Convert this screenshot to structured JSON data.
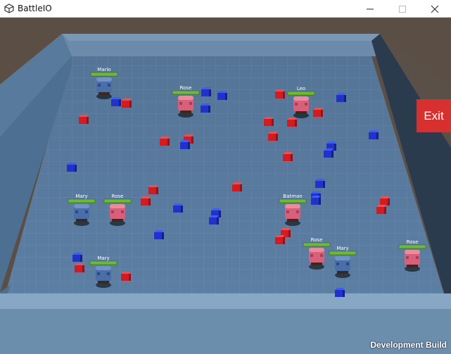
{
  "window": {
    "title": "BattleIO"
  },
  "ui": {
    "exit_label": "Exit",
    "build_label": "Development Build"
  },
  "colors": {
    "blue_team": "#2a3cd8",
    "red_team": "#e0202a",
    "exit_button": "#d8302f",
    "health_bar": "#6cbc2c"
  },
  "players": [
    {
      "name": "Mario",
      "team": "blue"
    },
    {
      "name": "Rose",
      "team": "red"
    },
    {
      "name": "Leo",
      "team": "red"
    },
    {
      "name": "Mary",
      "team": "blue"
    },
    {
      "name": "Rose",
      "team": "red"
    },
    {
      "name": "Batman",
      "team": "red"
    },
    {
      "name": "Mary",
      "team": "blue"
    },
    {
      "name": "Rose",
      "team": "red"
    },
    {
      "name": "Mary",
      "team": "blue"
    },
    {
      "name": "Rose",
      "team": "red"
    }
  ]
}
